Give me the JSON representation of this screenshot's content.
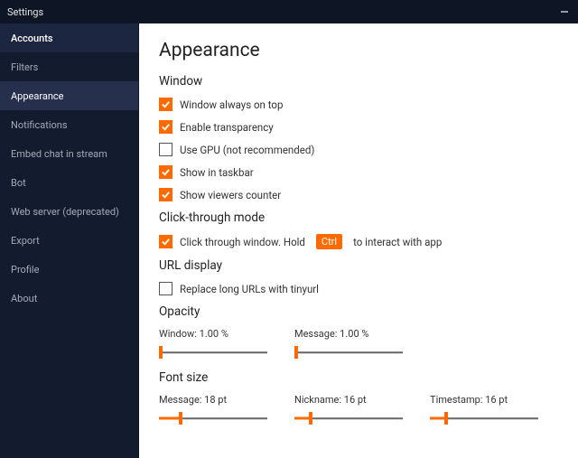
{
  "window": {
    "title": "Settings"
  },
  "sidebar": {
    "items": [
      {
        "label": "Accounts"
      },
      {
        "label": "Filters"
      },
      {
        "label": "Appearance"
      },
      {
        "label": "Notifications"
      },
      {
        "label": "Embed chat in stream"
      },
      {
        "label": "Bot"
      },
      {
        "label": "Web server (deprecated)"
      },
      {
        "label": "Export"
      },
      {
        "label": "Profile"
      },
      {
        "label": "About"
      }
    ]
  },
  "page": {
    "title": "Appearance",
    "groups": {
      "window": {
        "title": "Window",
        "always_on_top": "Window always on top",
        "transparency": "Enable transparency",
        "use_gpu": "Use GPU (not recommended)",
        "show_taskbar": "Show in taskbar",
        "show_viewers": "Show viewers counter"
      },
      "clickthrough": {
        "title": "Click-through mode",
        "label_pre": "Click through window. Hold",
        "key": "Ctrl",
        "label_post": "to interact with app"
      },
      "url": {
        "title": "URL display",
        "replace": "Replace long URLs with tinyurl"
      },
      "opacity": {
        "title": "Opacity",
        "window_label": "Window: 1.00 %",
        "message_label": "Message: 1.00 %"
      },
      "fontsize": {
        "title": "Font size",
        "message_label": "Message: 18 pt",
        "nickname_label": "Nickname: 16 pt",
        "timestamp_label": "Timestamp: 16 pt"
      }
    }
  },
  "colors": {
    "accent": "#ff6a00"
  }
}
